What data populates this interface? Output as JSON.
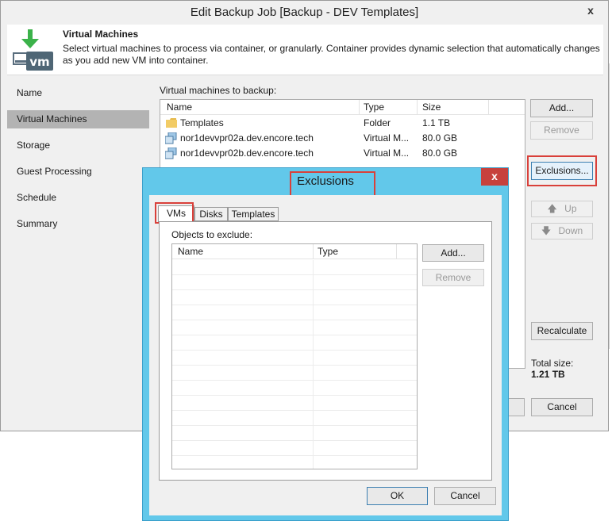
{
  "main_window": {
    "title": "Edit Backup Job [Backup - DEV Templates]",
    "close_glyph": "x",
    "header": {
      "title": "Virtual Machines",
      "description_line1": "Select virtual machines to process via container, or granularly. Container provides dynamic selection that automatically changes",
      "description_line2": "as you add new VM into container.",
      "logo_text": "vm"
    },
    "nav": [
      {
        "label": "Name"
      },
      {
        "label": "Virtual Machines",
        "selected": true
      },
      {
        "label": "Storage"
      },
      {
        "label": "Guest Processing"
      },
      {
        "label": "Schedule"
      },
      {
        "label": "Summary"
      }
    ],
    "vm_list_label": "Virtual machines to backup:",
    "columns": [
      "Name",
      "Type",
      "Size"
    ],
    "rows": [
      {
        "icon": "folder-icon",
        "name": "Templates",
        "type": "Folder",
        "size": "1.1 TB"
      },
      {
        "icon": "vm-icon",
        "name": "nor1devvpr02a.dev.encore.tech",
        "type": "Virtual M...",
        "size": "80.0 GB"
      },
      {
        "icon": "vm-icon",
        "name": "nor1devvpr02b.dev.encore.tech",
        "type": "Virtual M...",
        "size": "80.0 GB"
      }
    ],
    "buttons": {
      "add": "Add...",
      "remove": "Remove",
      "exclusions": "Exclusions...",
      "up": "Up",
      "down": "Down",
      "recalculate": "Recalculate",
      "cancel": "Cancel"
    },
    "total_size_label": "Total size:",
    "total_size_value": "1.21 TB"
  },
  "exclusions_dialog": {
    "title": "Exclusions",
    "close_glyph": "x",
    "tabs": [
      "VMs",
      "Disks",
      "Templates"
    ],
    "active_tab": "VMs",
    "objects_label": "Objects to exclude:",
    "columns": [
      "Name",
      "Type"
    ],
    "buttons": {
      "add": "Add...",
      "remove": "Remove",
      "ok": "OK",
      "cancel": "Cancel"
    }
  },
  "colors": {
    "dialog_title_bg": "#62c8ea",
    "close_red": "#c7413c",
    "highlight_red": "#d9403a",
    "nav_selected_bg": "#b3b3b3",
    "logo_green": "#3bb24a"
  }
}
